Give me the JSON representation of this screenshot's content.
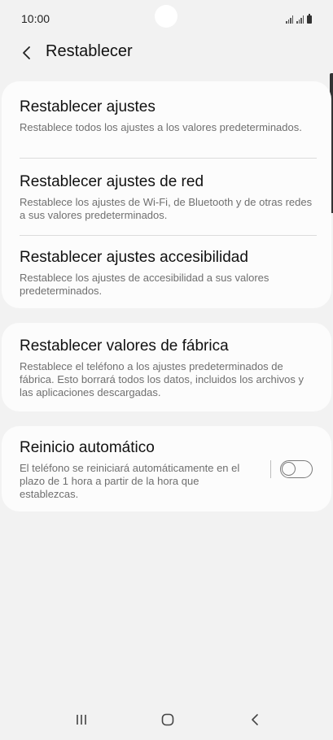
{
  "status_bar": {
    "time": "10:00"
  },
  "header": {
    "title": "Restablecer",
    "back_icon": "chevron-left-icon"
  },
  "cards": [
    {
      "items": [
        {
          "title": "Restablecer ajustes",
          "description": "Restablece todos los ajustes a los valores predeterminados."
        },
        {
          "title": "Restablecer ajustes de red",
          "description": "Restablece los ajustes de Wi-Fi, de Bluetooth y de otras redes a sus valores predeterminados."
        },
        {
          "title": "Restablecer ajustes accesibilidad",
          "description": "Restablece los ajustes de accesibilidad a sus valores predeterminados."
        }
      ]
    },
    {
      "items": [
        {
          "title": "Restablecer valores de fábrica",
          "description": "Restablece el teléfono a los ajustes predeterminados de fábrica. Esto borrará todos los datos, incluidos los archivos y las aplicaciones descargadas."
        }
      ]
    },
    {
      "items": [
        {
          "title": "Reinicio automático",
          "description": "El teléfono se reiniciará automáticamente en el plazo de 1 hora a partir de la hora que establezcas.",
          "toggle_on": false
        }
      ]
    }
  ],
  "colors": {
    "background": "#f2f2f2",
    "card": "#fcfcfc",
    "title_text": "#111111",
    "description_text": "#6f6f6f"
  },
  "nav_bar": {
    "recents_icon": "recents-icon",
    "home_icon": "home-icon",
    "back_icon": "back-icon"
  }
}
